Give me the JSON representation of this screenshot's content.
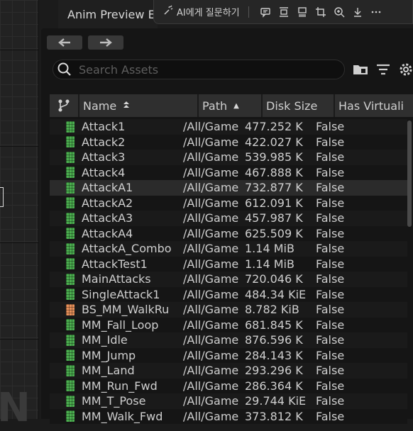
{
  "window": {
    "title": "Anim Preview E"
  },
  "ai_toolbar": {
    "ask_ai_label": "AI에게 질문하기"
  },
  "search": {
    "placeholder": "Search Assets",
    "value": ""
  },
  "table": {
    "columns": [
      {
        "label": "",
        "icon": "source-control-icon"
      },
      {
        "label": "Name",
        "sort": "▲"
      },
      {
        "label": "Path",
        "sort": "▲"
      },
      {
        "label": "Disk Size"
      },
      {
        "label": "Has Virtuali"
      }
    ],
    "selected_row": 4,
    "rows": [
      {
        "icon": "animation-sequence-icon",
        "name": "Attack1",
        "path": "/All/Game",
        "disk_size": "477.252 K",
        "has_virtualized": "False"
      },
      {
        "icon": "animation-sequence-icon",
        "name": "Attack2",
        "path": "/All/Game",
        "disk_size": "422.027 K",
        "has_virtualized": "False"
      },
      {
        "icon": "animation-sequence-icon",
        "name": "Attack3",
        "path": "/All/Game",
        "disk_size": "539.985 K",
        "has_virtualized": "False"
      },
      {
        "icon": "animation-sequence-icon",
        "name": "Attack4",
        "path": "/All/Game",
        "disk_size": "467.888 K",
        "has_virtualized": "False"
      },
      {
        "icon": "animation-sequence-icon",
        "name": "AttackA1",
        "path": "/All/Game",
        "disk_size": "732.877 K",
        "has_virtualized": "False"
      },
      {
        "icon": "animation-sequence-icon",
        "name": "AttackA2",
        "path": "/All/Game",
        "disk_size": "612.091 K",
        "has_virtualized": "False"
      },
      {
        "icon": "animation-sequence-icon",
        "name": "AttackA3",
        "path": "/All/Game",
        "disk_size": "457.987 K",
        "has_virtualized": "False"
      },
      {
        "icon": "animation-sequence-icon",
        "name": "AttackA4",
        "path": "/All/Game",
        "disk_size": "625.509 K",
        "has_virtualized": "False"
      },
      {
        "icon": "animation-sequence-icon",
        "name": "AttackA_Combo",
        "path": "/All/Game",
        "disk_size": "1.14 MiB",
        "has_virtualized": "False"
      },
      {
        "icon": "animation-sequence-icon",
        "name": "AttackTest1",
        "path": "/All/Game",
        "disk_size": "1.14 MiB",
        "has_virtualized": "False"
      },
      {
        "icon": "animation-sequence-icon",
        "name": "MainAttacks",
        "path": "/All/Game",
        "disk_size": "720.046 K",
        "has_virtualized": "False"
      },
      {
        "icon": "animation-sequence-icon",
        "name": "SingleAttack1",
        "path": "/All/Game",
        "disk_size": "484.34 KiE",
        "has_virtualized": "False"
      },
      {
        "icon": "blend-space-icon",
        "name": "BS_MM_WalkRu",
        "path": "/All/Game",
        "disk_size": "8.782 KiB",
        "has_virtualized": "False"
      },
      {
        "icon": "animation-sequence-icon",
        "name": "MM_Fall_Loop",
        "path": "/All/Game",
        "disk_size": "681.845 K",
        "has_virtualized": "False"
      },
      {
        "icon": "animation-sequence-icon",
        "name": "MM_Idle",
        "path": "/All/Game",
        "disk_size": "876.596 K",
        "has_virtualized": "False"
      },
      {
        "icon": "animation-sequence-icon",
        "name": "MM_Jump",
        "path": "/All/Game",
        "disk_size": "284.143 K",
        "has_virtualized": "False"
      },
      {
        "icon": "animation-sequence-icon",
        "name": "MM_Land",
        "path": "/All/Game",
        "disk_size": "293.296 K",
        "has_virtualized": "False"
      },
      {
        "icon": "animation-sequence-icon",
        "name": "MM_Run_Fwd",
        "path": "/All/Game",
        "disk_size": "286.364 K",
        "has_virtualized": "False"
      },
      {
        "icon": "animation-sequence-icon",
        "name": "MM_T_Pose",
        "path": "/All/Game",
        "disk_size": "29.744 KiE",
        "has_virtualized": "False"
      },
      {
        "icon": "animation-sequence-icon",
        "name": "MM_Walk_Fwd",
        "path": "/All/Game",
        "disk_size": "373.812 K",
        "has_virtualized": "False"
      }
    ]
  },
  "colors": {
    "anim_icon": "#4caf50",
    "blend_icon": "#e8915a",
    "selected_row": "#2b2b2b"
  }
}
